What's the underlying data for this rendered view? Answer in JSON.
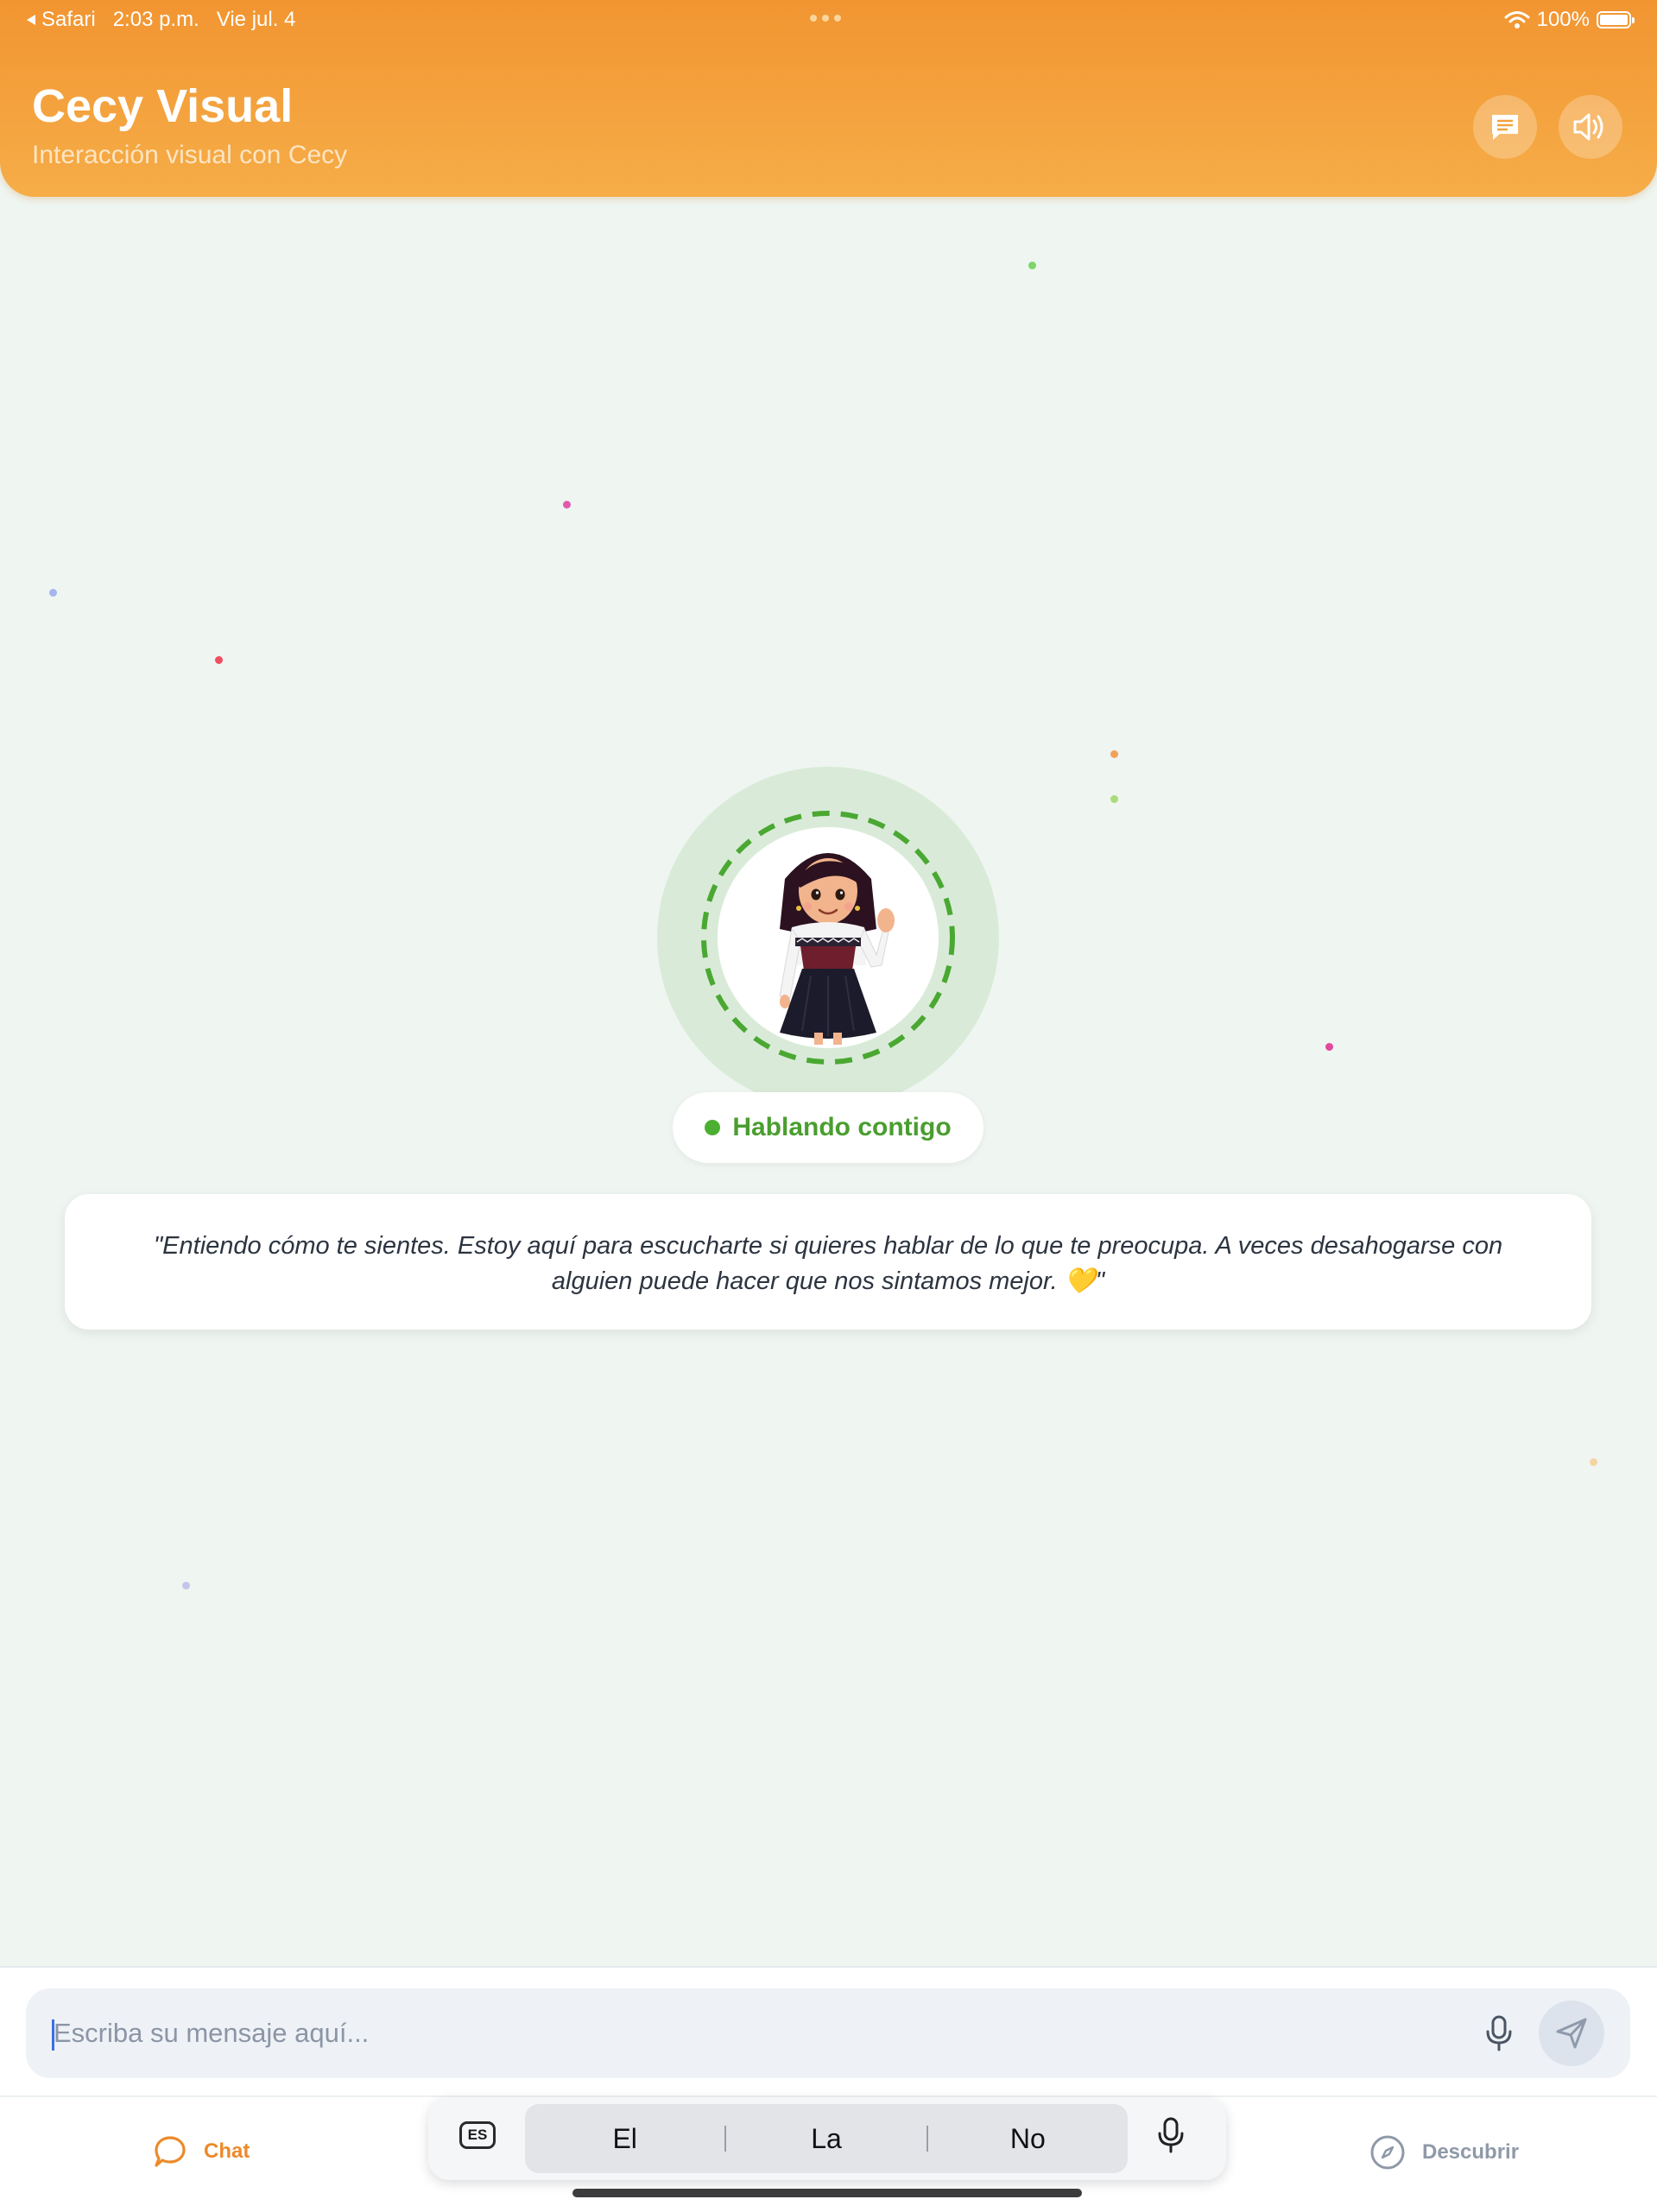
{
  "statusbar": {
    "back_app": "Safari",
    "time": "2:03 p.m.",
    "date": "Vie jul. 4",
    "battery": "100%"
  },
  "header": {
    "title": "Cecy Visual",
    "subtitle": "Interacción visual con Cecy",
    "icons": [
      "chat-bubble-icon",
      "volume-icon"
    ]
  },
  "avatar": {
    "status": "Hablando contigo",
    "status_color": "#4caf32"
  },
  "message": {
    "text": "\"Entiendo cómo te sientes. Estoy aquí para escucharte si quieres hablar de lo que te preocupa. A veces desahogarse con alguien puede hacer que nos sintamos mejor. 💛\""
  },
  "input": {
    "placeholder": "Escriba su mensaje aquí..."
  },
  "keyboard": {
    "lang": "ES",
    "suggestions": [
      "El",
      "La",
      "No"
    ]
  },
  "tabs": {
    "chat": "Chat",
    "discover": "Descubrir"
  },
  "colors": {
    "accent": "#f19531",
    "background": "#eff5f1",
    "active_tab": "#ec8a2a"
  }
}
